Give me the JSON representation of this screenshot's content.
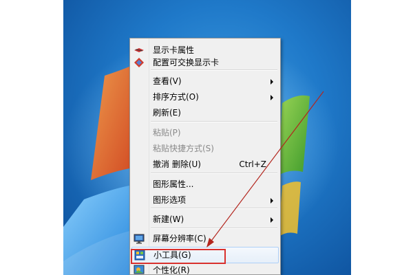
{
  "context_menu": {
    "items": [
      {
        "label": "显示卡属性",
        "shortcut": "",
        "submenu": false,
        "disabled": false,
        "icon": "graphics-props-icon"
      },
      {
        "label": "配置可交换显示卡",
        "shortcut": "",
        "submenu": false,
        "disabled": false,
        "icon": "switchable-graphics-icon"
      },
      {
        "label": "查看(V)",
        "shortcut": "",
        "submenu": true,
        "disabled": false,
        "icon": ""
      },
      {
        "label": "排序方式(O)",
        "shortcut": "",
        "submenu": true,
        "disabled": false,
        "icon": ""
      },
      {
        "label": "刷新(E)",
        "shortcut": "",
        "submenu": false,
        "disabled": false,
        "icon": ""
      },
      {
        "label": "粘贴(P)",
        "shortcut": "",
        "submenu": false,
        "disabled": true,
        "icon": ""
      },
      {
        "label": "粘贴快捷方式(S)",
        "shortcut": "",
        "submenu": false,
        "disabled": true,
        "icon": ""
      },
      {
        "label": "撤消 删除(U)",
        "shortcut": "Ctrl+Z",
        "submenu": false,
        "disabled": false,
        "icon": ""
      },
      {
        "label": "图形属性...",
        "shortcut": "",
        "submenu": false,
        "disabled": false,
        "icon": ""
      },
      {
        "label": "图形选项",
        "shortcut": "",
        "submenu": true,
        "disabled": false,
        "icon": ""
      },
      {
        "label": "新建(W)",
        "shortcut": "",
        "submenu": true,
        "disabled": false,
        "icon": ""
      },
      {
        "label": "屏幕分辨率(C)",
        "shortcut": "",
        "submenu": false,
        "disabled": false,
        "icon": "monitor-icon"
      },
      {
        "label": "小工具(G)",
        "shortcut": "",
        "submenu": false,
        "disabled": false,
        "icon": "gadgets-icon",
        "highlighted": true
      },
      {
        "label": "个性化(R)",
        "shortcut": "",
        "submenu": false,
        "disabled": false,
        "icon": "personalize-icon"
      }
    ]
  },
  "colors": {
    "annotation_red": "#d9302c",
    "menu_bg": "#f0f0f0",
    "desktop_blue": "#1f79c9"
  }
}
